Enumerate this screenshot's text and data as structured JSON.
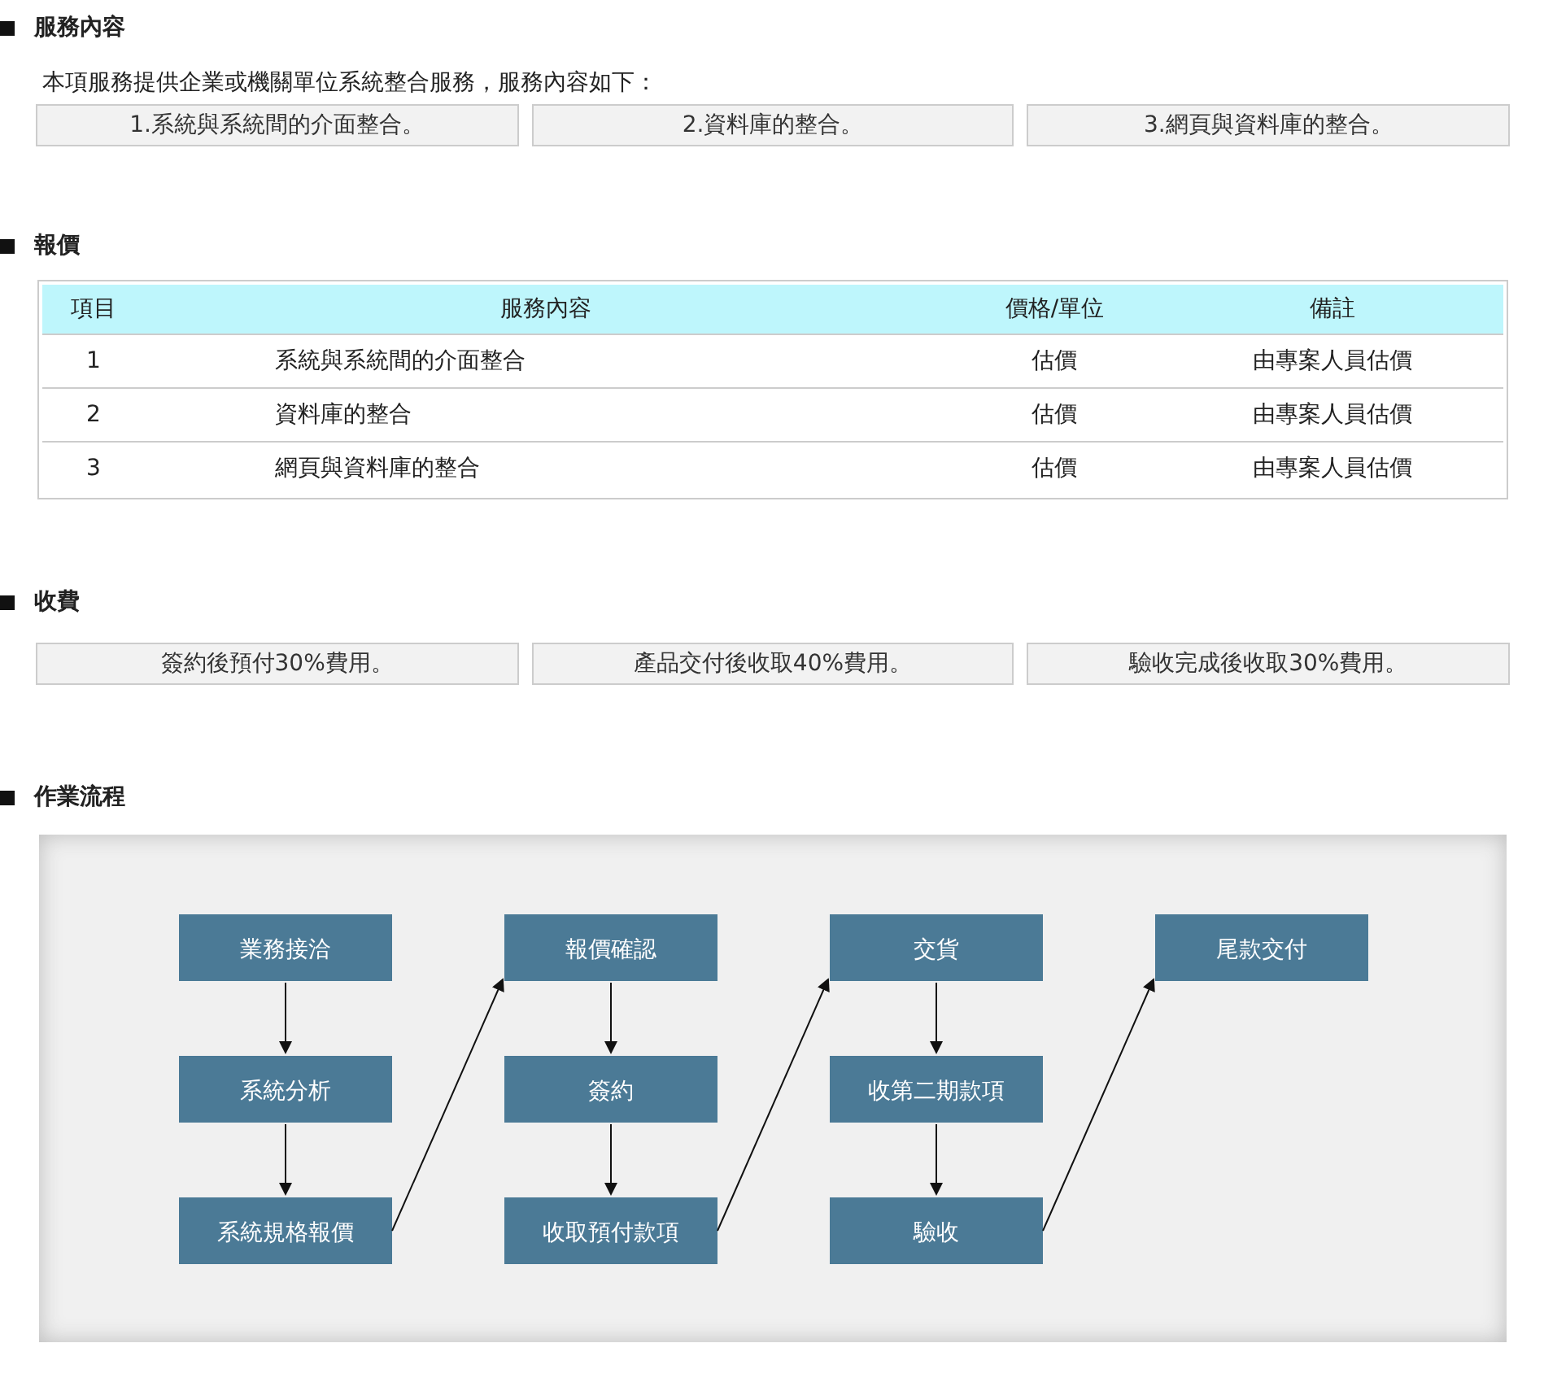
{
  "sections": [
    {
      "kind": "boxes",
      "title": "服務內容",
      "intro": "本項服務提供企業或機關單位系統整合服務，服務內容如下：",
      "boxes": [
        "1.系統與系統間的介面整合。",
        "2.資料庫的整合。",
        "3.網頁與資料庫的整合。"
      ]
    },
    {
      "kind": "table",
      "title": "報價",
      "columns": [
        "項目",
        "服務內容",
        "價格/單位",
        "備註"
      ],
      "rows": [
        [
          "1",
          "系統與系統間的介面整合",
          "估價",
          "由專案人員估價"
        ],
        [
          "2",
          "資料庫的整合",
          "估價",
          "由專案人員估價"
        ],
        [
          "3",
          "網頁與資料庫的整合",
          "估價",
          "由專案人員估價"
        ]
      ]
    },
    {
      "kind": "boxes",
      "title": "收費",
      "boxes": [
        "簽約後預付30%費用。",
        "產品交付後收取40%費用。",
        "驗收完成後收取30%費用。"
      ]
    },
    {
      "kind": "flow",
      "title": "作業流程",
      "columns": [
        [
          "業務接洽",
          "系統分析",
          "系統規格報價"
        ],
        [
          "報價確認",
          "簽約",
          "收取預付款項"
        ],
        [
          "交貨",
          "收第二期款項",
          "驗收"
        ],
        [
          "尾款交付"
        ]
      ]
    }
  ]
}
